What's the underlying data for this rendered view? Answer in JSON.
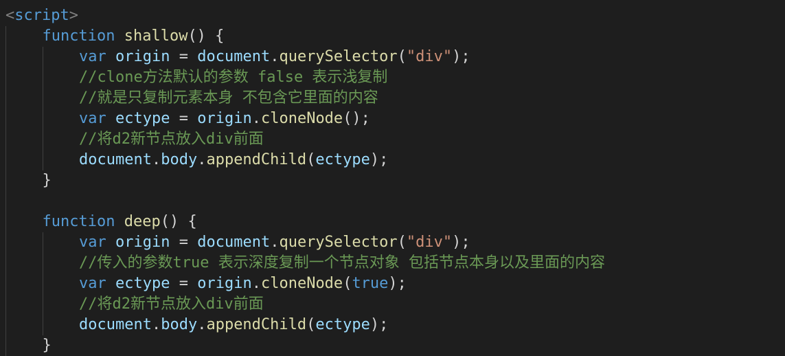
{
  "editor": {
    "background": "#1e1e1e",
    "lines": [
      {
        "indent": 0,
        "tokens": [
          {
            "t": "<",
            "c": "tag-bracket"
          },
          {
            "t": "script",
            "c": "tag"
          },
          {
            "t": ">",
            "c": "tag-bracket"
          }
        ]
      },
      {
        "indent": 1,
        "tokens": [
          {
            "t": "function",
            "c": "keyword"
          },
          {
            "t": " ",
            "c": "punct"
          },
          {
            "t": "shallow",
            "c": "function"
          },
          {
            "t": "() {",
            "c": "punct"
          }
        ]
      },
      {
        "indent": 2,
        "tokens": [
          {
            "t": "var",
            "c": "keyword"
          },
          {
            "t": " ",
            "c": "punct"
          },
          {
            "t": "origin",
            "c": "variable"
          },
          {
            "t": " = ",
            "c": "punct"
          },
          {
            "t": "document",
            "c": "variable"
          },
          {
            "t": ".",
            "c": "punct"
          },
          {
            "t": "querySelector",
            "c": "function"
          },
          {
            "t": "(",
            "c": "punct"
          },
          {
            "t": "\"div\"",
            "c": "string"
          },
          {
            "t": ");",
            "c": "punct"
          }
        ]
      },
      {
        "indent": 2,
        "tokens": [
          {
            "t": "//clone方法默认的参数 false 表示浅复制",
            "c": "comment"
          }
        ]
      },
      {
        "indent": 2,
        "tokens": [
          {
            "t": "//就是只复制元素本身 不包含它里面的内容",
            "c": "comment"
          }
        ]
      },
      {
        "indent": 2,
        "tokens": [
          {
            "t": "var",
            "c": "keyword"
          },
          {
            "t": " ",
            "c": "punct"
          },
          {
            "t": "ectype",
            "c": "variable"
          },
          {
            "t": " = ",
            "c": "punct"
          },
          {
            "t": "origin",
            "c": "variable"
          },
          {
            "t": ".",
            "c": "punct"
          },
          {
            "t": "cloneNode",
            "c": "function"
          },
          {
            "t": "();",
            "c": "punct"
          }
        ]
      },
      {
        "indent": 2,
        "tokens": [
          {
            "t": "//将d2新节点放入div前面",
            "c": "comment"
          }
        ]
      },
      {
        "indent": 2,
        "tokens": [
          {
            "t": "document",
            "c": "variable"
          },
          {
            "t": ".",
            "c": "punct"
          },
          {
            "t": "body",
            "c": "variable"
          },
          {
            "t": ".",
            "c": "punct"
          },
          {
            "t": "appendChild",
            "c": "function"
          },
          {
            "t": "(",
            "c": "punct"
          },
          {
            "t": "ectype",
            "c": "variable"
          },
          {
            "t": ");",
            "c": "punct"
          }
        ]
      },
      {
        "indent": 1,
        "tokens": [
          {
            "t": "}",
            "c": "punct"
          }
        ]
      },
      {
        "indent": 0,
        "tokens": []
      },
      {
        "indent": 1,
        "tokens": [
          {
            "t": "function",
            "c": "keyword"
          },
          {
            "t": " ",
            "c": "punct"
          },
          {
            "t": "deep",
            "c": "function"
          },
          {
            "t": "() {",
            "c": "punct"
          }
        ]
      },
      {
        "indent": 2,
        "tokens": [
          {
            "t": "var",
            "c": "keyword"
          },
          {
            "t": " ",
            "c": "punct"
          },
          {
            "t": "origin",
            "c": "variable"
          },
          {
            "t": " = ",
            "c": "punct"
          },
          {
            "t": "document",
            "c": "variable"
          },
          {
            "t": ".",
            "c": "punct"
          },
          {
            "t": "querySelector",
            "c": "function"
          },
          {
            "t": "(",
            "c": "punct"
          },
          {
            "t": "\"div\"",
            "c": "string"
          },
          {
            "t": ");",
            "c": "punct"
          }
        ]
      },
      {
        "indent": 2,
        "tokens": [
          {
            "t": "//传入的参数true 表示深度复制一个节点对象 包括节点本身以及里面的内容",
            "c": "comment"
          }
        ]
      },
      {
        "indent": 2,
        "tokens": [
          {
            "t": "var",
            "c": "keyword"
          },
          {
            "t": " ",
            "c": "punct"
          },
          {
            "t": "ectype",
            "c": "variable"
          },
          {
            "t": " = ",
            "c": "punct"
          },
          {
            "t": "origin",
            "c": "variable"
          },
          {
            "t": ".",
            "c": "punct"
          },
          {
            "t": "cloneNode",
            "c": "function"
          },
          {
            "t": "(",
            "c": "punct"
          },
          {
            "t": "true",
            "c": "boolean"
          },
          {
            "t": ");",
            "c": "punct"
          }
        ]
      },
      {
        "indent": 2,
        "tokens": [
          {
            "t": "//将d2新节点放入div前面",
            "c": "comment"
          }
        ]
      },
      {
        "indent": 2,
        "tokens": [
          {
            "t": "document",
            "c": "variable"
          },
          {
            "t": ".",
            "c": "punct"
          },
          {
            "t": "body",
            "c": "variable"
          },
          {
            "t": ".",
            "c": "punct"
          },
          {
            "t": "appendChild",
            "c": "function"
          },
          {
            "t": "(",
            "c": "punct"
          },
          {
            "t": "ectype",
            "c": "variable"
          },
          {
            "t": ");",
            "c": "punct"
          }
        ]
      },
      {
        "indent": 1,
        "tokens": [
          {
            "t": "}",
            "c": "punct"
          }
        ]
      }
    ]
  }
}
